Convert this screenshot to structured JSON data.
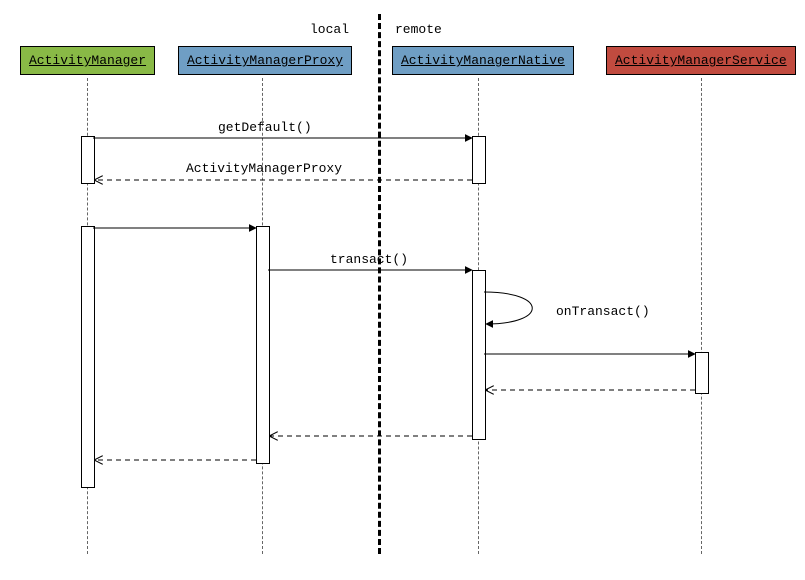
{
  "regions": {
    "local": "local",
    "remote": "remote"
  },
  "participants": {
    "am": {
      "label": "ActivityManager",
      "color": "#89b946"
    },
    "amp": {
      "label": "ActivityManagerProxy",
      "color": "#6f9ec4"
    },
    "amn": {
      "label": "ActivityManagerNative",
      "color": "#6f9ec4"
    },
    "ams": {
      "label": "ActivityManagerService",
      "color": "#c14b3f"
    }
  },
  "messages": {
    "getDefault": "getDefault()",
    "returnProxy": "ActivityManagerProxy",
    "transact": "transact()",
    "onTransact": "onTransact()"
  },
  "chart_data": {
    "type": "sequence-diagram",
    "regions": [
      {
        "name": "local",
        "participants": [
          "ActivityManager",
          "ActivityManagerProxy"
        ]
      },
      {
        "name": "remote",
        "participants": [
          "ActivityManagerNative",
          "ActivityManagerService"
        ]
      }
    ],
    "participants": [
      "ActivityManager",
      "ActivityManagerProxy",
      "ActivityManagerNative",
      "ActivityManagerService"
    ],
    "interactions": [
      {
        "from": "ActivityManager",
        "to": "ActivityManagerNative",
        "label": "getDefault()",
        "kind": "call"
      },
      {
        "from": "ActivityManagerNative",
        "to": "ActivityManager",
        "label": "ActivityManagerProxy",
        "kind": "return"
      },
      {
        "from": "ActivityManager",
        "to": "ActivityManagerProxy",
        "label": "",
        "kind": "call"
      },
      {
        "from": "ActivityManagerProxy",
        "to": "ActivityManagerNative",
        "label": "transact()",
        "kind": "call"
      },
      {
        "from": "ActivityManagerNative",
        "to": "ActivityManagerNative",
        "label": "onTransact()",
        "kind": "self"
      },
      {
        "from": "ActivityManagerNative",
        "to": "ActivityManagerService",
        "label": "",
        "kind": "call"
      },
      {
        "from": "ActivityManagerService",
        "to": "ActivityManagerNative",
        "label": "",
        "kind": "return"
      },
      {
        "from": "ActivityManagerNative",
        "to": "ActivityManagerProxy",
        "label": "",
        "kind": "return"
      },
      {
        "from": "ActivityManagerProxy",
        "to": "ActivityManager",
        "label": "",
        "kind": "return"
      }
    ]
  }
}
